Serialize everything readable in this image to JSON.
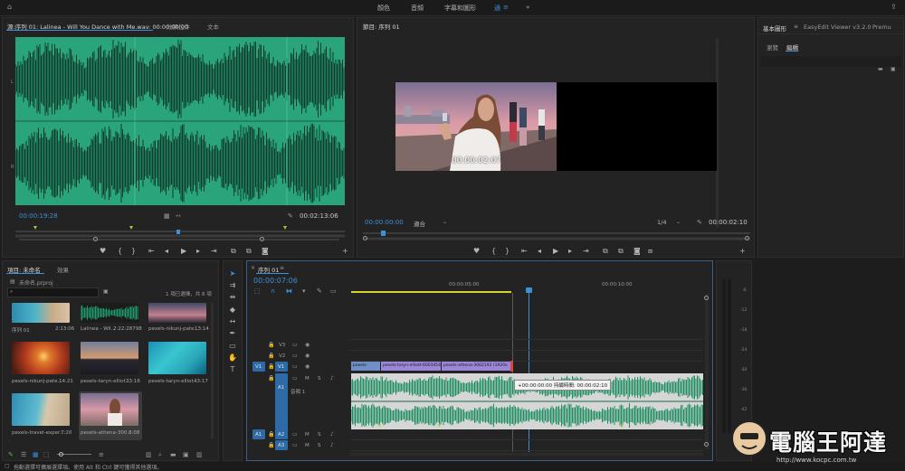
{
  "topbar": {
    "home_icon": "home-icon",
    "workspaces": [
      "顏色",
      "音頻",
      "字幕和圖形"
    ],
    "active_workspace": "通",
    "menu_icon": "≡",
    "more": "»"
  },
  "source": {
    "tabs": [
      "源:序列 01: Lalinea - Will You Dance with Me.wav: 00:00:00:00",
      "效果控件",
      "文本"
    ],
    "current_time": "00:00:19:28",
    "duration": "00:02:13:06",
    "ch1": "L",
    "ch2": "R"
  },
  "program": {
    "tab": "節目: 序列 01",
    "caption": "00:00:02:07",
    "current_time": "00:00:00:00",
    "fit": "適合",
    "quality": "1/4",
    "duration": "00:00:02:10"
  },
  "right_panel": {
    "tabs": [
      "基本圖形",
      "EasyEdit Viewer v3.2.0",
      "Premu"
    ],
    "subtabs": [
      "瀏覽",
      "編輯"
    ]
  },
  "project": {
    "tabs": [
      "項目: 未命名",
      "效果"
    ],
    "file": "未命名.prproj",
    "selection": "1 項已選擇，共 8 項",
    "items": [
      {
        "name": "序列 01",
        "dur": "2:13:06"
      },
      {
        "name": "Lalinea - Wil...",
        "dur": "2:22:28798"
      },
      {
        "name": "pexels-nikunj-pate...",
        "dur": "13:14"
      },
      {
        "name": "pexels-nikunj-pate...",
        "dur": "14:21"
      },
      {
        "name": "pexels-taryn-elliot...",
        "dur": "33:16"
      },
      {
        "name": "pexels-taryn-elliot...",
        "dur": "43:17"
      },
      {
        "name": "pexels-travel-exper...",
        "dur": "7:20"
      },
      {
        "name": "pexels-athena-300...",
        "dur": "8:08"
      }
    ]
  },
  "timeline": {
    "tab": "序列 01",
    "current_time": "00:00:07:06",
    "ruler": [
      "00:00:05:00",
      "00:00:10:00"
    ],
    "tracks_video": [
      "V3",
      "V2",
      "V1"
    ],
    "tracks_audio": [
      "A1",
      "A2",
      "A3"
    ],
    "source_v": "V1",
    "source_a": "A1",
    "audio_name": "音頻 1",
    "clips": [
      "pexels-",
      "pexels-taryn-elliott-6003454",
      "pexels-athena-3002192 (1920x"
    ],
    "tooltip": "+00:00:00:00 持續時間: 00:00:02:10",
    "mute": "M",
    "solo": "S"
  },
  "meter": {
    "ticks": [
      "-6",
      "-12",
      "-18",
      "-24",
      "-30",
      "-36",
      "-42",
      "-48"
    ],
    "bottom": "dB"
  },
  "status": "拖動選擇可擴展選擇項。使用 Alt 和 Ctrl 鍵可獲得其他選項。",
  "watermark": {
    "brand": "電腦王阿達",
    "url": "http://www.kocpc.com.tw"
  },
  "colors": {
    "accent": "#3d8fd6",
    "waveform": "#1e9c6e",
    "clip_purple": "#9b86d8",
    "clip_blue": "#6f8fc7",
    "yellow": "#d8d12a"
  }
}
